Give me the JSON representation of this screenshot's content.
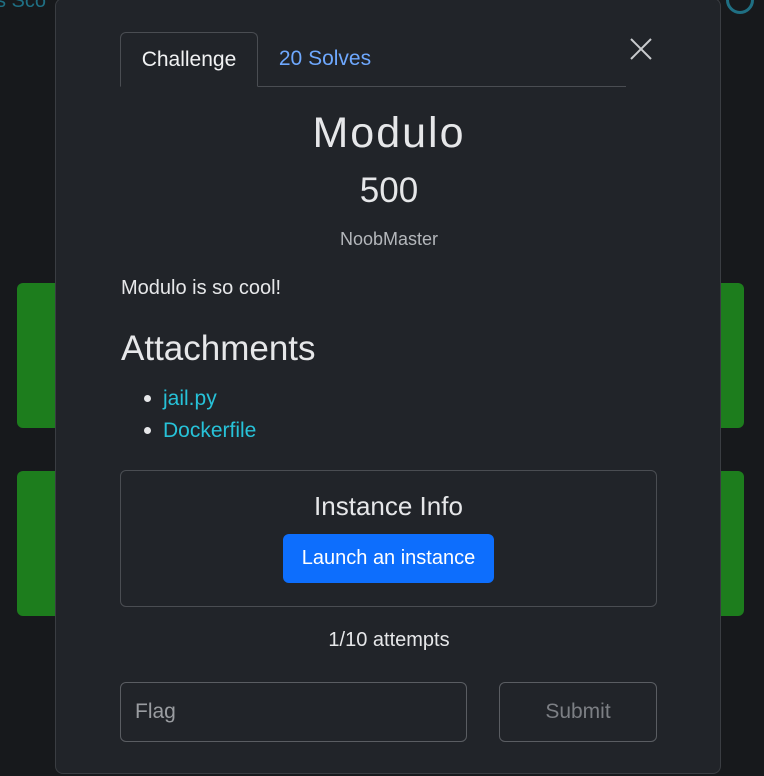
{
  "background": {
    "nav_text": "s   Sco"
  },
  "modal": {
    "tabs": [
      {
        "label": "Challenge",
        "active": true
      },
      {
        "label": "20 Solves",
        "active": false
      }
    ],
    "challenge": {
      "name": "Modulo",
      "points": "500",
      "author": "NoobMaster",
      "description": "Modulo is so cool!"
    },
    "attachments": {
      "heading": "Attachments",
      "files": [
        "jail.py",
        "Dockerfile"
      ]
    },
    "instance": {
      "title": "Instance Info",
      "launch_label": "Launch an instance"
    },
    "attempts": "1/10 attempts",
    "flag_form": {
      "placeholder": "Flag",
      "value": "",
      "submit_label": "Submit",
      "submit_disabled": true
    }
  },
  "colors": {
    "modal_bg": "#212429",
    "link": "#27c2d8",
    "tab_link": "#6ea8fe",
    "primary_button": "#0d6efd",
    "card_green": "#1d7d1d"
  },
  "icons": {
    "close": "close-icon",
    "user": "user-circle-icon"
  }
}
